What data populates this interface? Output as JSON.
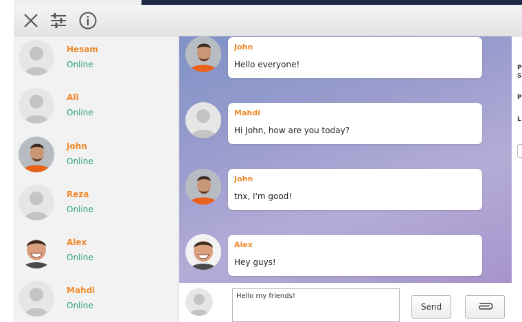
{
  "toolbar": {
    "icons": [
      "close-icon",
      "sliders-icon",
      "info-icon"
    ]
  },
  "contacts": [
    {
      "name": "Hesam",
      "status": "Online",
      "avatar": "default-user-icon"
    },
    {
      "name": "Ali",
      "status": "Online",
      "avatar": "default-user-icon"
    },
    {
      "name": "John",
      "status": "Online",
      "avatar": "john-photo"
    },
    {
      "name": "Reza",
      "status": "Online",
      "avatar": "default-user-icon"
    },
    {
      "name": "Alex",
      "status": "Online",
      "avatar": "alex-photo"
    },
    {
      "name": "Mahdi",
      "status": "Online",
      "avatar": "default-user-icon"
    }
  ],
  "messages": [
    {
      "sender": "John",
      "text": "Hello everyone!"
    },
    {
      "sender": "Mahdi",
      "text": "Hi John, how are you today?"
    },
    {
      "sender": "John",
      "text": "tnx, I'm good!"
    },
    {
      "sender": "Alex",
      "text": "Hey guys!"
    }
  ],
  "composer": {
    "input_value": "Hello my friends!",
    "send_label": "Send",
    "attach_icon": "paperclip-icon"
  },
  "right_panel": {
    "fragments": [
      "P",
      "S",
      "P",
      "L"
    ]
  },
  "colors": {
    "name": "#ef8a2c",
    "online": "#2aa07a",
    "chat_bg_start": "#7f92c7",
    "chat_bg_end": "#a694cb",
    "top_strip": "#1e2a44"
  }
}
